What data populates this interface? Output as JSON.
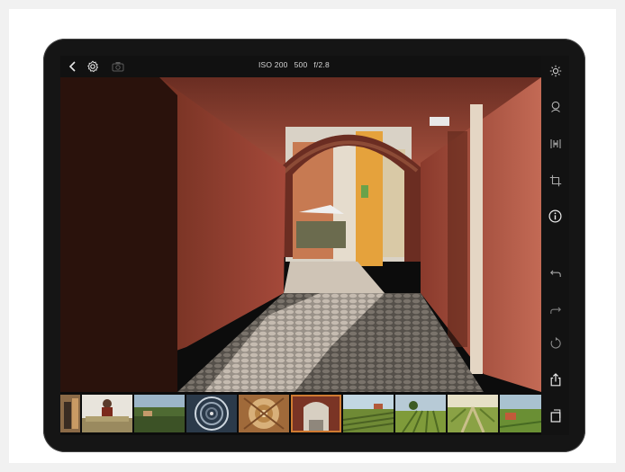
{
  "exif": {
    "iso": "ISO 200",
    "shutter": "500",
    "aperture": "f/2.8"
  },
  "icons": {
    "top": [
      "back-chevron-icon",
      "settings-gear-icon",
      "camera-icon"
    ],
    "sidebar": [
      "brightness-sun-icon",
      "color-filter-icon",
      "compare-icon",
      "crop-icon",
      "info-icon",
      "undo-icon",
      "redo-icon",
      "revert-icon",
      "share-icon",
      "export-icon"
    ]
  },
  "filmstrip": {
    "count": 10,
    "selected_index": 5
  },
  "colors": {
    "accent": "#d07b32",
    "ui_text": "#d6d6d6",
    "chrome": "#151515"
  }
}
